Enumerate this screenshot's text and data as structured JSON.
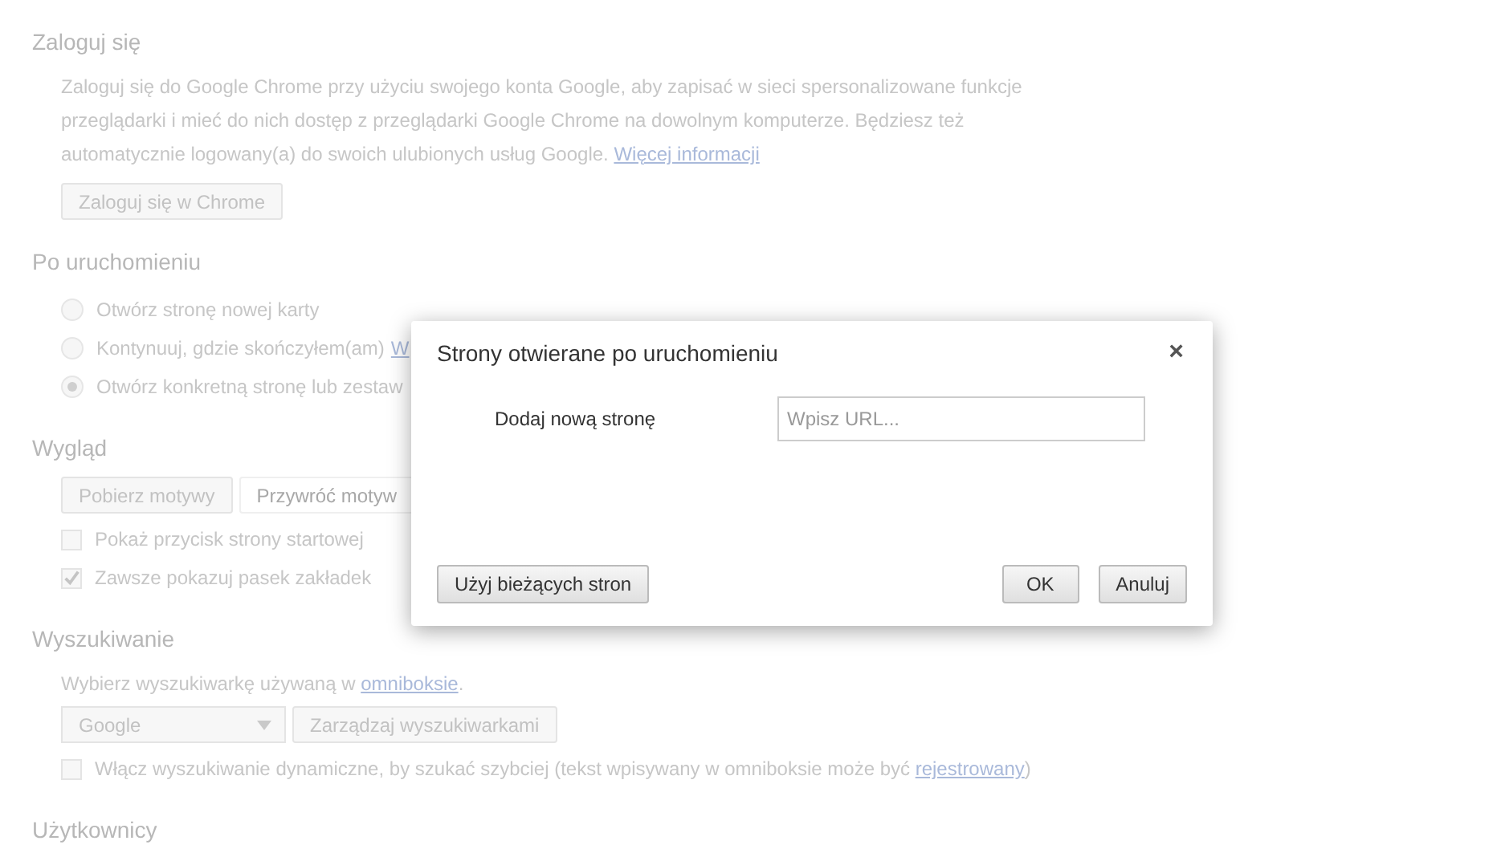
{
  "sections": [
    {
      "title": "Zaloguj się",
      "description": {
        "text": "Zaloguj się do Google Chrome przy użyciu swojego konta Google, aby zapisać w sieci spersonalizowane funkcje przeglądarki i mieć do nich dostęp z przeglądarki Google Chrome na dowolnym komputerze. Będziesz też automatycznie logowany(a) do swoich ulubionych usług Google. ",
        "link": "Więcej informacji"
      },
      "controls": [
        {
          "kind": "button",
          "label": "Zaloguj się w Chrome"
        }
      ]
    },
    {
      "title": "Po uruchomieniu",
      "controls": [
        {
          "kind": "radio",
          "label": "Otwórz stronę nowej karty",
          "selected": false
        },
        {
          "kind": "radio",
          "label": "Kontynuuj, gdzie skończyłem(am)",
          "link": "W",
          "selected": false
        },
        {
          "kind": "radio",
          "label": "Otwórz konkretną stronę lub zestaw",
          "selected": true
        }
      ]
    },
    {
      "title": "Wygląd",
      "controls": [
        {
          "kind": "buttons",
          "buttons": [
            {
              "label": "Pobierz motywy",
              "disabled": false
            },
            {
              "label": "Przywróć motyw",
              "disabled": true
            }
          ]
        },
        {
          "kind": "checkbox",
          "label": "Pokaż przycisk strony startowej",
          "checked": false
        },
        {
          "kind": "checkbox",
          "label": "Zawsze pokazuj pasek zakładek",
          "checked": true
        }
      ]
    },
    {
      "title": "Wyszukiwanie",
      "controls": [
        {
          "kind": "text",
          "text": "Wybierz wyszukiwarkę używaną w ",
          "link": "omniboksie",
          "after": "."
        },
        {
          "kind": "select",
          "value": "Google",
          "button": "Zarządzaj wyszukiwarkami"
        },
        {
          "kind": "checkbox",
          "label": "Włącz wyszukiwanie dynamiczne, by szukać szybciej (tekst wpisywany w omniboksie może być ",
          "link": "rejestrowany",
          "after": ")",
          "checked": false
        }
      ]
    },
    {
      "title": "Użytkownicy"
    }
  ],
  "dialog": {
    "title": "Strony otwierane po uruchomieniu",
    "close": "×",
    "label": "Dodaj nową stronę",
    "placeholder": "Wpisz URL...",
    "use_current": "Użyj bieżących stron",
    "ok": "OK",
    "cancel": "Anuluj"
  }
}
